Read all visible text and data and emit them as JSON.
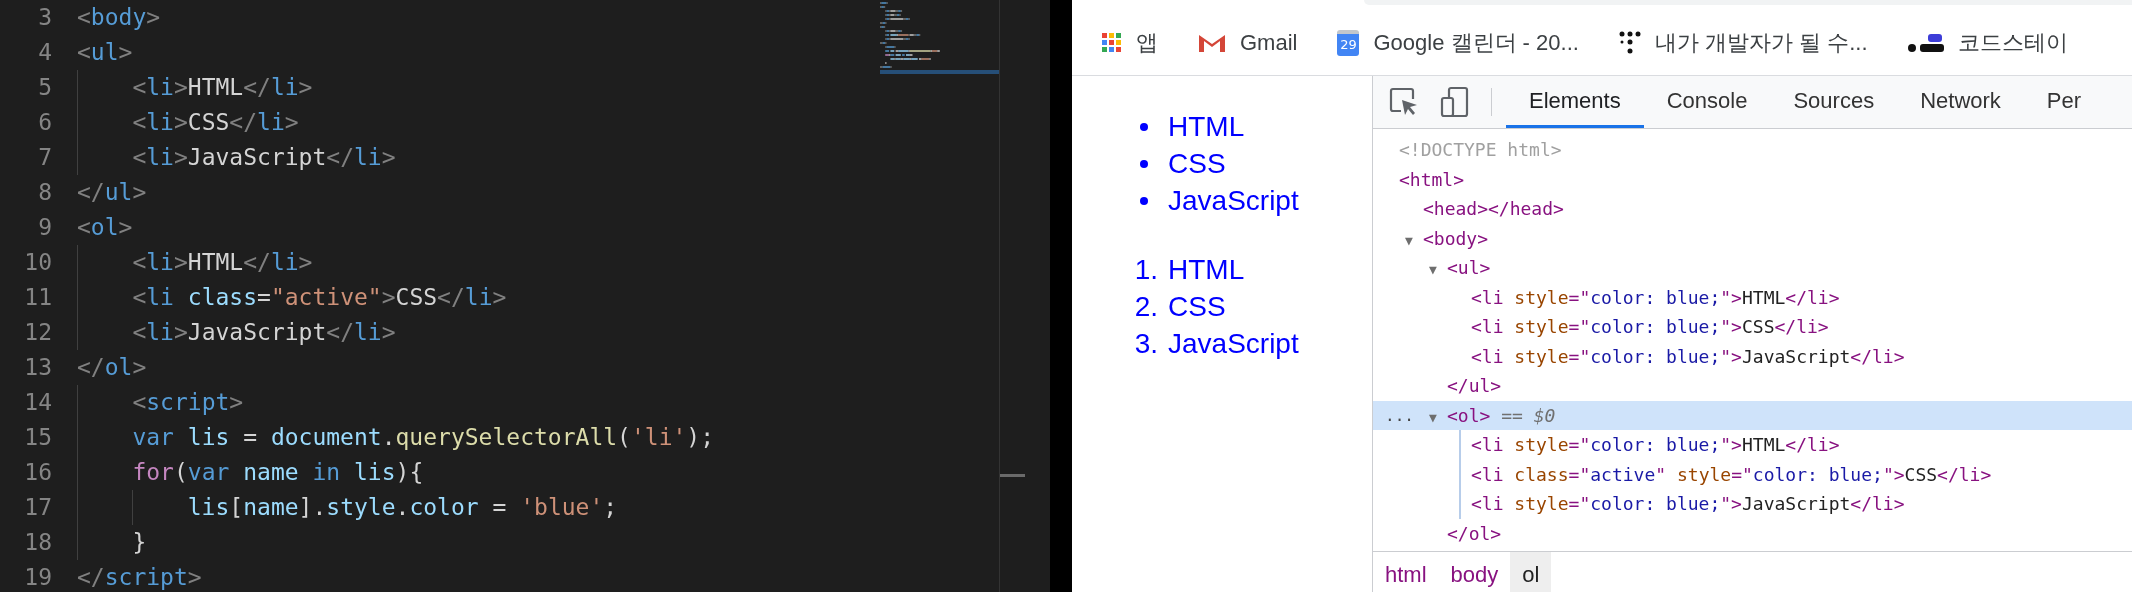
{
  "editor": {
    "lines": [
      {
        "number": "3",
        "tokens": [
          {
            "t": "<",
            "kind": "punct"
          },
          {
            "t": "body",
            "kind": "tag"
          },
          {
            "t": ">",
            "kind": "punct"
          }
        ]
      },
      {
        "number": "4",
        "tokens": [
          {
            "t": "<",
            "kind": "punct"
          },
          {
            "t": "ul",
            "kind": "tag"
          },
          {
            "t": ">",
            "kind": "punct"
          }
        ]
      },
      {
        "number": "5",
        "tokens": [
          {
            "t": "    <",
            "kind": "punct"
          },
          {
            "t": "li",
            "kind": "tag"
          },
          {
            "t": ">",
            "kind": "punct"
          },
          {
            "t": "HTML",
            "kind": "text"
          },
          {
            "t": "</",
            "kind": "punct"
          },
          {
            "t": "li",
            "kind": "tag"
          },
          {
            "t": ">",
            "kind": "punct"
          }
        ]
      },
      {
        "number": "6",
        "tokens": [
          {
            "t": "    <",
            "kind": "punct"
          },
          {
            "t": "li",
            "kind": "tag"
          },
          {
            "t": ">",
            "kind": "punct"
          },
          {
            "t": "CSS",
            "kind": "text"
          },
          {
            "t": "</",
            "kind": "punct"
          },
          {
            "t": "li",
            "kind": "tag"
          },
          {
            "t": ">",
            "kind": "punct"
          }
        ]
      },
      {
        "number": "7",
        "tokens": [
          {
            "t": "    <",
            "kind": "punct"
          },
          {
            "t": "li",
            "kind": "tag"
          },
          {
            "t": ">",
            "kind": "punct"
          },
          {
            "t": "JavaScript",
            "kind": "text"
          },
          {
            "t": "</",
            "kind": "punct"
          },
          {
            "t": "li",
            "kind": "tag"
          },
          {
            "t": ">",
            "kind": "punct"
          }
        ]
      },
      {
        "number": "8",
        "tokens": [
          {
            "t": "</",
            "kind": "punct"
          },
          {
            "t": "ul",
            "kind": "tag"
          },
          {
            "t": ">",
            "kind": "punct"
          }
        ]
      },
      {
        "number": "9",
        "tokens": [
          {
            "t": "<",
            "kind": "punct"
          },
          {
            "t": "ol",
            "kind": "tag"
          },
          {
            "t": ">",
            "kind": "punct"
          }
        ]
      },
      {
        "number": "10",
        "tokens": [
          {
            "t": "    <",
            "kind": "punct"
          },
          {
            "t": "li",
            "kind": "tag"
          },
          {
            "t": ">",
            "kind": "punct"
          },
          {
            "t": "HTML",
            "kind": "text"
          },
          {
            "t": "</",
            "kind": "punct"
          },
          {
            "t": "li",
            "kind": "tag"
          },
          {
            "t": ">",
            "kind": "punct"
          }
        ]
      },
      {
        "number": "11",
        "tokens": [
          {
            "t": "    <",
            "kind": "punct"
          },
          {
            "t": "li",
            "kind": "tag"
          },
          {
            "t": " class",
            "kind": "attr"
          },
          {
            "t": "=",
            "kind": "text"
          },
          {
            "t": "\"active\"",
            "kind": "string"
          },
          {
            "t": ">",
            "kind": "punct"
          },
          {
            "t": "CSS",
            "kind": "text"
          },
          {
            "t": "</",
            "kind": "punct"
          },
          {
            "t": "li",
            "kind": "tag"
          },
          {
            "t": ">",
            "kind": "punct"
          }
        ]
      },
      {
        "number": "12",
        "tokens": [
          {
            "t": "    <",
            "kind": "punct"
          },
          {
            "t": "li",
            "kind": "tag"
          },
          {
            "t": ">",
            "kind": "punct"
          },
          {
            "t": "JavaScript",
            "kind": "text"
          },
          {
            "t": "</",
            "kind": "punct"
          },
          {
            "t": "li",
            "kind": "tag"
          },
          {
            "t": ">",
            "kind": "punct"
          }
        ]
      },
      {
        "number": "13",
        "tokens": [
          {
            "t": "</",
            "kind": "punct"
          },
          {
            "t": "ol",
            "kind": "tag"
          },
          {
            "t": ">",
            "kind": "punct"
          }
        ]
      },
      {
        "number": "14",
        "tokens": [
          {
            "t": "    <",
            "kind": "punct"
          },
          {
            "t": "script",
            "kind": "tag"
          },
          {
            "t": ">",
            "kind": "punct"
          }
        ]
      },
      {
        "number": "15",
        "tokens": [
          {
            "t": "    var",
            "kind": "keyword"
          },
          {
            "t": " lis",
            "kind": "variable"
          },
          {
            "t": " = ",
            "kind": "text"
          },
          {
            "t": "document",
            "kind": "variable"
          },
          {
            "t": ".",
            "kind": "text"
          },
          {
            "t": "querySelectorAll",
            "kind": "func"
          },
          {
            "t": "(",
            "kind": "text"
          },
          {
            "t": "'li'",
            "kind": "string"
          },
          {
            "t": ");",
            "kind": "text"
          }
        ]
      },
      {
        "number": "16",
        "tokens": [
          {
            "t": "    for",
            "kind": "control"
          },
          {
            "t": "(",
            "kind": "text"
          },
          {
            "t": "var",
            "kind": "keyword"
          },
          {
            "t": " name",
            "kind": "variable"
          },
          {
            "t": " in",
            "kind": "keyword"
          },
          {
            "t": " lis",
            "kind": "variable"
          },
          {
            "t": "){",
            "kind": "text"
          }
        ]
      },
      {
        "number": "17",
        "tokens": [
          {
            "t": "        lis",
            "kind": "variable"
          },
          {
            "t": "[",
            "kind": "text"
          },
          {
            "t": "name",
            "kind": "variable"
          },
          {
            "t": "].",
            "kind": "text"
          },
          {
            "t": "style",
            "kind": "variable"
          },
          {
            "t": ".",
            "kind": "text"
          },
          {
            "t": "color",
            "kind": "variable"
          },
          {
            "t": " = ",
            "kind": "text"
          },
          {
            "t": "'blue'",
            "kind": "string"
          },
          {
            "t": ";",
            "kind": "text"
          }
        ]
      },
      {
        "number": "18",
        "tokens": [
          {
            "t": "    }",
            "kind": "text"
          }
        ]
      },
      {
        "number": "19",
        "tokens": [
          {
            "t": "</",
            "kind": "punct"
          },
          {
            "t": "script",
            "kind": "tag"
          },
          {
            "t": ">",
            "kind": "punct"
          }
        ]
      }
    ]
  },
  "bookmarks": [
    {
      "kind": "apps",
      "label": "앱"
    },
    {
      "kind": "mail",
      "label": "Gmail"
    },
    {
      "kind": "calendar",
      "badge": "29",
      "label": "Google 캘린더 - 20..."
    },
    {
      "kind": "dots",
      "label": "내가 개발자가 될 수..."
    },
    {
      "kind": "dotbar",
      "label": "코드스테이"
    }
  ],
  "page": {
    "unordered": [
      "HTML",
      "CSS",
      "JavaScript"
    ],
    "ordered": [
      {
        "marker": "1.",
        "text": "HTML"
      },
      {
        "marker": "2.",
        "text": "CSS"
      },
      {
        "marker": "3.",
        "text": "JavaScript"
      }
    ]
  },
  "devtools": {
    "tabs": [
      {
        "label": "Elements",
        "selected": true
      },
      {
        "label": "Console",
        "selected": false
      },
      {
        "label": "Sources",
        "selected": false
      },
      {
        "label": "Network",
        "selected": false
      },
      {
        "label": "Per",
        "selected": false
      }
    ],
    "tree": [
      {
        "selected": false,
        "tokens": [
          {
            "t": "<!DOCTYPE html>",
            "kind": "doctype"
          }
        ]
      },
      {
        "selected": false,
        "tokens": [
          {
            "t": "<html>",
            "kind": "tag"
          }
        ],
        "children": [
          {
            "selected": false,
            "tokens": [
              {
                "t": "<head></head>",
                "kind": "tag"
              }
            ]
          },
          {
            "selected": false,
            "expanded": true,
            "toggle": "▼",
            "tokens": [
              {
                "t": "<body>",
                "kind": "tag"
              }
            ],
            "children": [
              {
                "selected": false,
                "expanded": true,
                "toggle": "▼",
                "tokens": [
                  {
                    "t": "<ul>",
                    "kind": "tag"
                  }
                ],
                "closing": [
                  {
                    "t": "</ul>",
                    "kind": "tag"
                  }
                ],
                "children": [
                  {
                    "selected": false,
                    "tokens": [
                      {
                        "t": "<li ",
                        "kind": "tag"
                      },
                      {
                        "t": "style",
                        "kind": "attr"
                      },
                      {
                        "t": "=\"",
                        "kind": "tag"
                      },
                      {
                        "t": "color: blue;",
                        "kind": "value"
                      },
                      {
                        "t": "\">",
                        "kind": "tag"
                      },
                      {
                        "t": "HTML",
                        "kind": "text"
                      },
                      {
                        "t": "</li>",
                        "kind": "tag"
                      }
                    ]
                  },
                  {
                    "selected": false,
                    "tokens": [
                      {
                        "t": "<li ",
                        "kind": "tag"
                      },
                      {
                        "t": "style",
                        "kind": "attr"
                      },
                      {
                        "t": "=\"",
                        "kind": "tag"
                      },
                      {
                        "t": "color: blue;",
                        "kind": "value"
                      },
                      {
                        "t": "\">",
                        "kind": "tag"
                      },
                      {
                        "t": "CSS",
                        "kind": "text"
                      },
                      {
                        "t": "</li>",
                        "kind": "tag"
                      }
                    ]
                  },
                  {
                    "selected": false,
                    "tokens": [
                      {
                        "t": "<li ",
                        "kind": "tag"
                      },
                      {
                        "t": "style",
                        "kind": "attr"
                      },
                      {
                        "t": "=\"",
                        "kind": "tag"
                      },
                      {
                        "t": "color: blue;",
                        "kind": "value"
                      },
                      {
                        "t": "\">",
                        "kind": "tag"
                      },
                      {
                        "t": "JavaScript",
                        "kind": "text"
                      },
                      {
                        "t": "</li>",
                        "kind": "tag"
                      }
                    ]
                  }
                ]
              },
              {
                "selected": true,
                "expanded": true,
                "toggle": "▼",
                "more": "...",
                "tokens": [
                  {
                    "t": "<ol>",
                    "kind": "tag"
                  },
                  {
                    "t": " == ",
                    "kind": "eq"
                  },
                  {
                    "t": "$0",
                    "kind": "ref"
                  }
                ],
                "closing": [
                  {
                    "t": "</ol>",
                    "kind": "tag"
                  }
                ],
                "children": [
                  {
                    "selected": false,
                    "tokens": [
                      {
                        "t": "<li ",
                        "kind": "tag"
                      },
                      {
                        "t": "style",
                        "kind": "attr"
                      },
                      {
                        "t": "=\"",
                        "kind": "tag"
                      },
                      {
                        "t": "color: blue;",
                        "kind": "value"
                      },
                      {
                        "t": "\">",
                        "kind": "tag"
                      },
                      {
                        "t": "HTML",
                        "kind": "text"
                      },
                      {
                        "t": "</li>",
                        "kind": "tag"
                      }
                    ]
                  },
                  {
                    "selected": false,
                    "tokens": [
                      {
                        "t": "<li ",
                        "kind": "tag"
                      },
                      {
                        "t": "class",
                        "kind": "attr"
                      },
                      {
                        "t": "=\"",
                        "kind": "tag"
                      },
                      {
                        "t": "active",
                        "kind": "value"
                      },
                      {
                        "t": "\" ",
                        "kind": "tag"
                      },
                      {
                        "t": "style",
                        "kind": "attr"
                      },
                      {
                        "t": "=\"",
                        "kind": "tag"
                      },
                      {
                        "t": "color: blue;",
                        "kind": "value"
                      },
                      {
                        "t": "\">",
                        "kind": "tag"
                      },
                      {
                        "t": "CSS",
                        "kind": "text"
                      },
                      {
                        "t": "</li>",
                        "kind": "tag"
                      }
                    ]
                  },
                  {
                    "selected": false,
                    "tokens": [
                      {
                        "t": "<li ",
                        "kind": "tag"
                      },
                      {
                        "t": "style",
                        "kind": "attr"
                      },
                      {
                        "t": "=\"",
                        "kind": "tag"
                      },
                      {
                        "t": "color: blue;",
                        "kind": "value"
                      },
                      {
                        "t": "\">",
                        "kind": "tag"
                      },
                      {
                        "t": "JavaScript",
                        "kind": "text"
                      },
                      {
                        "t": "</li>",
                        "kind": "tag"
                      }
                    ]
                  }
                ]
              }
            ]
          }
        ]
      }
    ],
    "breadcrumbs": [
      {
        "label": "html",
        "selected": false
      },
      {
        "label": "body",
        "selected": false
      },
      {
        "label": "ol",
        "selected": true
      }
    ]
  }
}
